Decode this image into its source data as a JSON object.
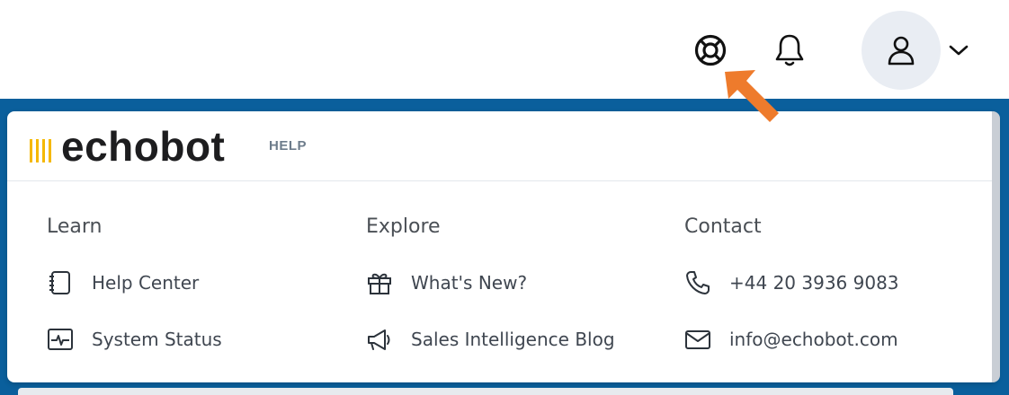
{
  "topbar": {
    "icons": {
      "help": "lifebuoy-icon",
      "notifications": "bell-icon",
      "user": "user-icon",
      "menu": "chevron-down-icon"
    }
  },
  "help_panel": {
    "logo_text": "echobot",
    "tag": "HELP",
    "columns": [
      {
        "title": "Learn",
        "links": [
          {
            "label": "Help Center",
            "icon": "notebook-icon"
          },
          {
            "label": "System Status",
            "icon": "status-monitor-icon"
          }
        ]
      },
      {
        "title": "Explore",
        "links": [
          {
            "label": "What's New?",
            "icon": "gift-icon"
          },
          {
            "label": "Sales Intelligence Blog",
            "icon": "megaphone-icon"
          }
        ]
      },
      {
        "title": "Contact",
        "links": [
          {
            "label": "+44 20 3936 9083",
            "icon": "phone-icon"
          },
          {
            "label": "info@echobot.com",
            "icon": "mail-icon"
          }
        ]
      }
    ]
  },
  "colors": {
    "brand_blue": "#0a5f9c",
    "logo_yellow": "#f5b800",
    "highlight_arrow": "#ee7b2c",
    "text": "#3f4650"
  }
}
